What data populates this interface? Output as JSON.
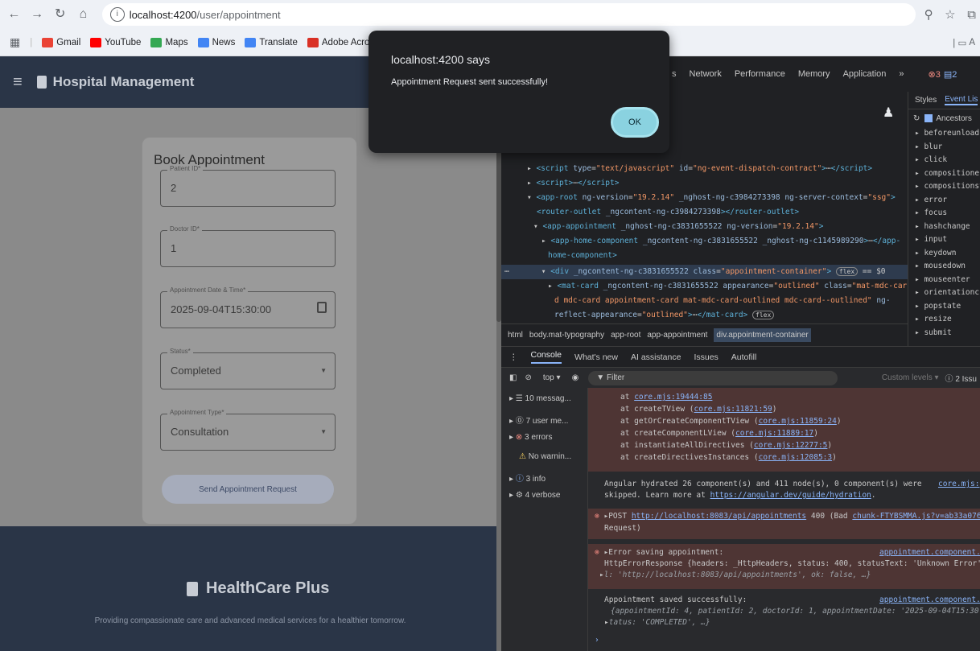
{
  "browser": {
    "url_host": "localhost:4200",
    "url_path": "/user/appointment",
    "bookmarks": [
      {
        "label": "Gmail",
        "color": "#ea4335"
      },
      {
        "label": "YouTube",
        "color": "#ff0000"
      },
      {
        "label": "Maps",
        "color": "#34a853"
      },
      {
        "label": "News",
        "color": "#4285f4"
      },
      {
        "label": "Translate",
        "color": "#4285f4"
      },
      {
        "label": "Adobe Acrobat",
        "color": "#d93025"
      }
    ],
    "folder_label": "A"
  },
  "app": {
    "title": "Hospital Management",
    "form_title": "Book Appointment",
    "fields": [
      {
        "label": "Patient ID*",
        "value": "2"
      },
      {
        "label": "Doctor ID*",
        "value": "1"
      },
      {
        "label": "Appointment Date & Time*",
        "value": "2025-09-04T15:30:00"
      },
      {
        "label": "Status*",
        "value": "Completed"
      },
      {
        "label": "Appointment Type*",
        "value": "Consultation"
      }
    ],
    "submit_label": "Send Appointment Request",
    "footer_brand": "HealthCare Plus",
    "footer_tagline": "Providing compassionate care and advanced medical services for a healthier tomorrow."
  },
  "dialog": {
    "title": "localhost:4200 says",
    "message": "Appointment Request sent successfully!",
    "ok_label": "OK"
  },
  "devtools": {
    "tabs": [
      "s",
      "Network",
      "Performance",
      "Memory",
      "Application"
    ],
    "error_count": "3",
    "warn_count": "2",
    "styles_tabs": [
      "Styles",
      "Event Lis"
    ],
    "ancestors_label": "Ancestors",
    "events": [
      "beforeunload",
      "blur",
      "click",
      "compositionen",
      "compositionst",
      "error",
      "focus",
      "hashchange",
      "input",
      "keydown",
      "mousedown",
      "mouseenter",
      "orientationch",
      "popstate",
      "resize",
      "submit"
    ],
    "breadcrumbs": [
      "html",
      "body.mat-typography",
      "app-root",
      "app-appointment",
      "div.appointment-container"
    ],
    "console_tabs": [
      "Console",
      "What's new",
      "AI assistance",
      "Issues",
      "Autofill"
    ],
    "context": "top",
    "filter_placeholder": "Filter",
    "custom_levels": "Custom levels",
    "issues_count": "2 Issu",
    "sidebar": [
      {
        "icon": "list",
        "label": "10 messag..."
      },
      {
        "icon": "user",
        "label": "7 user me..."
      },
      {
        "icon": "error",
        "label": "3 errors"
      },
      {
        "icon": "warning",
        "label": "No warnin..."
      },
      {
        "icon": "info",
        "label": "3 info"
      },
      {
        "icon": "verbose",
        "label": "4 verbose"
      }
    ],
    "stack": [
      {
        "fn": "at",
        "loc": "core.mjs:19444:85"
      },
      {
        "fn": "at createTView",
        "loc": "core.mjs:11821:59"
      },
      {
        "fn": "at getOrCreateComponentTView",
        "loc": "core.mjs:11859:24"
      },
      {
        "fn": "at createComponentLView",
        "loc": "core.mjs:11889:17"
      },
      {
        "fn": "at instantiateAllDirectives",
        "loc": "core.mjs:12277:5"
      },
      {
        "fn": "at createDirectivesInstances",
        "loc": "core.mjs:12085:3"
      }
    ],
    "hydration_line1": "Angular hydrated 26 component(s) and 411 node(s), 0 component(s) were",
    "hydration_line2": "skipped. Learn more at",
    "hydration_link": "https://angular.dev/guide/hydration",
    "hydration_src": "core.mjs:",
    "post_prefix": "POST",
    "post_url": "http://localhost:8083/api/appointments",
    "post_status": "400 (Bad",
    "post_src": "chunk-FTYBSMMA.js?v=ab33a076:",
    "post_line2": "Request)",
    "err_title": "Error saving appointment:",
    "err_src": "appointment.component.",
    "err_body1": "HttpErrorResponse {headers: _HttpHeaders, status: 400, statusText: 'Unknown Error'",
    "err_body2": "l: 'http://localhost:8083/api/appointments', ok: false, …}",
    "ok_title": "Appointment saved successfully:",
    "ok_src": "appointment.component.",
    "ok_body1": "{appointmentId: 4, patientId: 2, doctorId: 1, appointmentDate: '2025-09-04T15:30:",
    "ok_body2": "tatus: 'COMPLETED', …}"
  }
}
